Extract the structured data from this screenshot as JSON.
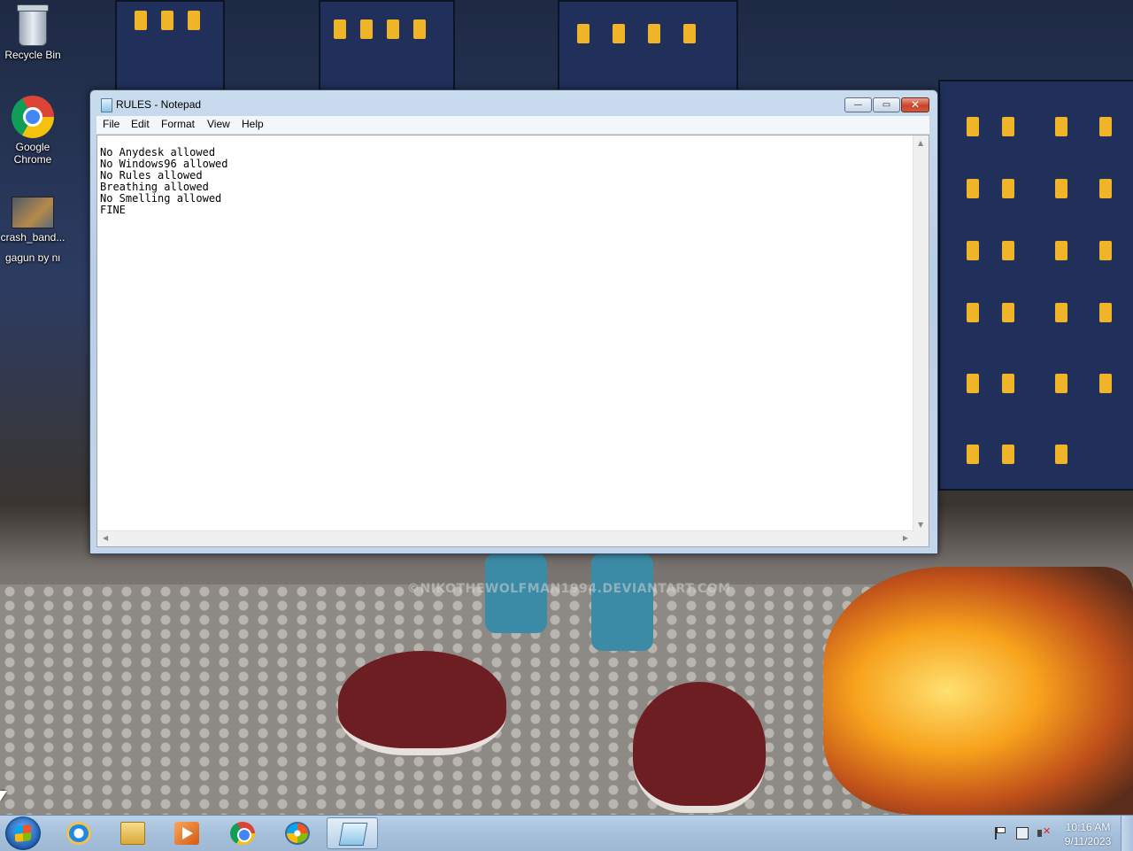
{
  "desktop": {
    "icons": [
      {
        "label": "Recycle Bin",
        "icon": "recycle-bin-icon"
      },
      {
        "label": "Google Chrome",
        "icon": "chrome-icon"
      },
      {
        "label": "crash_band...",
        "icon": "image-file-icon"
      },
      {
        "label": "gagun by ni",
        "icon": "image-file-icon"
      }
    ],
    "watermark": "©NIKOTHEWOLFMAN1994.DEVIANTART.COM"
  },
  "window": {
    "title": "RULES - Notepad",
    "buttons": {
      "minimize": "—",
      "maximize": "▭",
      "close": "✕"
    },
    "menu": [
      "File",
      "Edit",
      "Format",
      "View",
      "Help"
    ],
    "content_lines": [
      "No Anydesk allowed",
      "No Windows96 allowed",
      "No Rules allowed",
      "Breathing allowed",
      "No Smelling allowed",
      "FINE"
    ]
  },
  "taskbar": {
    "pinned": [
      {
        "name": "Internet Explorer",
        "icon": "internet-explorer-icon"
      },
      {
        "name": "Windows Explorer",
        "icon": "folder-icon"
      },
      {
        "name": "Windows Media Player",
        "icon": "media-player-icon"
      },
      {
        "name": "Google Chrome",
        "icon": "chrome-icon"
      },
      {
        "name": "Windows",
        "icon": "windows-icon"
      },
      {
        "name": "Notepad",
        "icon": "notepad-icon",
        "active": true
      }
    ],
    "tray": {
      "icons": [
        "action-center-flag-icon",
        "network-icon",
        "volume-muted-icon"
      ],
      "time": "10:16 AM",
      "date": "9/11/2023"
    }
  }
}
